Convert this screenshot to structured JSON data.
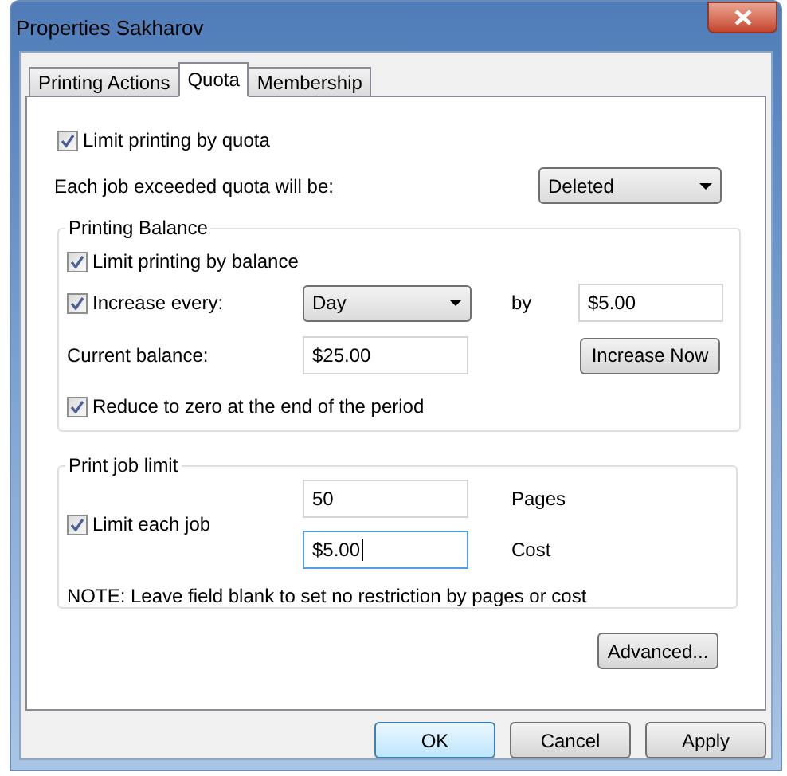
{
  "window": {
    "title": "Properties Sakharov"
  },
  "tabs": [
    {
      "label": "Printing Actions",
      "selected": false
    },
    {
      "label": "Quota",
      "selected": true
    },
    {
      "label": "Membership",
      "selected": false
    }
  ],
  "quota": {
    "limit_by_quota": {
      "label": "Limit printing by quota",
      "checked": true
    },
    "exceeded_label": "Each job exceeded quota will be:",
    "exceeded_action": {
      "value": "Deleted"
    }
  },
  "printing_balance": {
    "title": "Printing Balance",
    "limit_by_balance": {
      "label": "Limit printing by balance",
      "checked": true
    },
    "increase_every": {
      "label": "Increase every:",
      "checked": true
    },
    "period": {
      "value": "Day"
    },
    "by_label": "by",
    "increase_amount": {
      "value": "$5.00"
    },
    "current_balance_label": "Current balance:",
    "current_balance": {
      "value": "$25.00"
    },
    "increase_now_button": "Increase Now",
    "reduce_to_zero": {
      "label": "Reduce to zero at the end of the period",
      "checked": true
    }
  },
  "print_job_limit": {
    "title": "Print job limit",
    "limit_each_job": {
      "label": "Limit each job",
      "checked": true
    },
    "pages": {
      "value": "50",
      "focused": false
    },
    "pages_label": "Pages",
    "cost": {
      "value": "$5.00",
      "focused": true
    },
    "cost_label": "Cost",
    "note": "NOTE: Leave field blank to set no restriction by pages or cost"
  },
  "advanced_button": "Advanced...",
  "buttons": [
    {
      "label": "OK",
      "default": true
    },
    {
      "label": "Cancel",
      "default": false
    },
    {
      "label": "Apply",
      "default": false
    }
  ]
}
